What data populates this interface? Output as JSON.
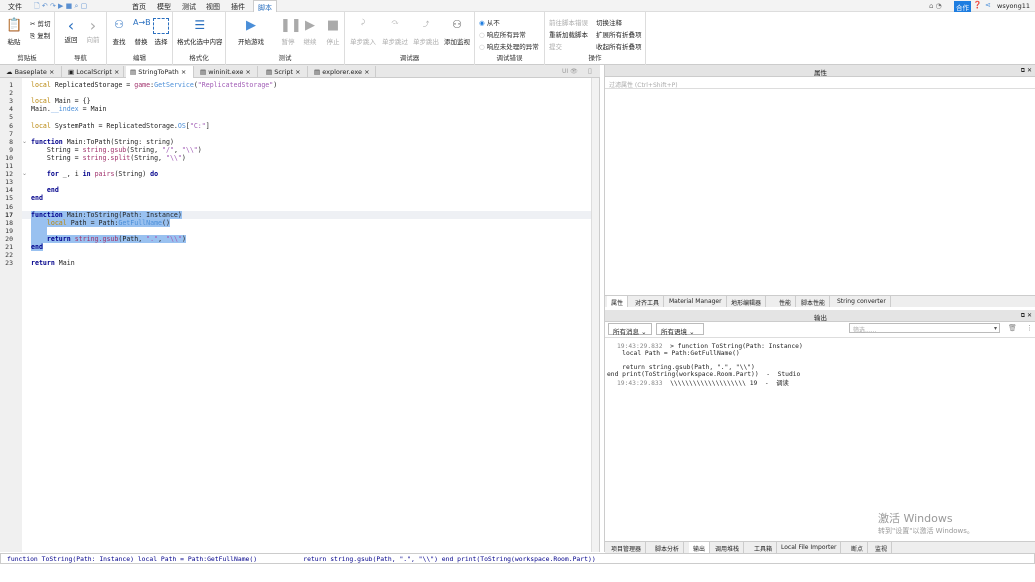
{
  "menu": {
    "file": "文件",
    "items": [
      "首页",
      "模型",
      "测试",
      "视图",
      "插件",
      "脚本"
    ],
    "active": "脚本"
  },
  "titlebar": {
    "collab": "合作",
    "user": "wsyong11"
  },
  "ribbon": {
    "clipboard": {
      "paste": "粘贴",
      "cut": "剪切",
      "copy": "复制",
      "label": "剪贴板"
    },
    "nav": {
      "back": "返回",
      "forward": "向前",
      "label": "导航"
    },
    "edit": {
      "find": "查找",
      "replace": "替换",
      "select": "选择",
      "label": "编辑"
    },
    "format": {
      "format_selection": "格式化选中内容",
      "label": "格式化"
    },
    "test": {
      "start": "开始游戏",
      "pause": "暂停",
      "resume": "继续",
      "stop": "停止",
      "label": "测试"
    },
    "debugger": {
      "step_into": "单步跳入",
      "step_over": "单步跳过",
      "step_out": "单步跳出",
      "add_watch": "添加监视",
      "label": "调试器"
    },
    "debug_errors": {
      "never": "从不",
      "all": "响应所有异常",
      "unhandled": "响应未处理的异常",
      "label": "调试错误"
    },
    "actions": {
      "goto_error": "前往脚本错误",
      "reload": "重新加载脚本",
      "commit": "提交",
      "toggle_comment": "切换注释",
      "expand_all": "扩展所有折叠项",
      "collapse_all": "收起所有折叠项",
      "label": "操作"
    }
  },
  "tabs": [
    "Baseplate",
    "LocalScript",
    "StringToPath",
    "wininit.exe",
    "Script",
    "explorer.exe"
  ],
  "active_tab": "StringToPath",
  "ui_toggle": "UI",
  "code": [
    [
      [
        "local",
        "kl"
      ],
      [
        " ReplicatedStorage = ",
        "pl"
      ],
      [
        "game",
        "bi"
      ],
      [
        ":",
        "pl"
      ],
      [
        "GetService",
        "fn"
      ],
      [
        "(",
        "pl"
      ],
      [
        "\"ReplicatedStorage\"",
        "st"
      ],
      [
        ")",
        "pl"
      ]
    ],
    [],
    [
      [
        "local",
        "kl"
      ],
      [
        " Main = {}",
        "pl"
      ]
    ],
    [
      [
        "Main.",
        "pl"
      ],
      [
        "__index",
        "fn"
      ],
      [
        " = Main",
        "pl"
      ]
    ],
    [],
    [
      [
        "local",
        "kl"
      ],
      [
        " SystemPath = ReplicatedStorage.",
        "pl"
      ],
      [
        "OS",
        "fn"
      ],
      [
        "[",
        "pl"
      ],
      [
        "\"C:\"",
        "st"
      ],
      [
        "]",
        "pl"
      ]
    ],
    [],
    [
      [
        "function",
        "kw"
      ],
      [
        " Main:ToPath(String: string)",
        "pl"
      ]
    ],
    [
      [
        "    String = ",
        "pl"
      ],
      [
        "string.gsub",
        "bi"
      ],
      [
        "(String, ",
        "pl"
      ],
      [
        "\"/\"",
        "st"
      ],
      [
        ", ",
        "pl"
      ],
      [
        "\"\\\\\"",
        "st"
      ],
      [
        ")",
        "pl"
      ]
    ],
    [
      [
        "    String = ",
        "pl"
      ],
      [
        "string.split",
        "bi"
      ],
      [
        "(String, ",
        "pl"
      ],
      [
        "\"\\\\\"",
        "st"
      ],
      [
        ")",
        "pl"
      ]
    ],
    [],
    [
      [
        "    ",
        "pl"
      ],
      [
        "for",
        "kw"
      ],
      [
        " _, i ",
        "pl"
      ],
      [
        "in",
        "kw"
      ],
      [
        " ",
        "pl"
      ],
      [
        "pairs",
        "bi"
      ],
      [
        "(String) ",
        "pl"
      ],
      [
        "do",
        "kw"
      ]
    ],
    [],
    [
      [
        "    ",
        "pl"
      ],
      [
        "end",
        "kw"
      ]
    ],
    [
      [
        "end",
        "kw"
      ]
    ],
    [],
    [
      [
        "function",
        "kw"
      ],
      [
        " Main:ToString(Path: Instance)",
        "pl"
      ]
    ],
    [
      [
        "    ",
        "pl"
      ],
      [
        "local",
        "kl"
      ],
      [
        " Path = Path:",
        "pl"
      ],
      [
        "GetFullName",
        "fn"
      ],
      [
        "()",
        "pl"
      ]
    ],
    [
      [
        "    ",
        "pl"
      ]
    ],
    [
      [
        "    ",
        "pl"
      ],
      [
        "return",
        "kw"
      ],
      [
        " ",
        "pl"
      ],
      [
        "string.gsub",
        "bi"
      ],
      [
        "(Path, ",
        "pl"
      ],
      [
        "\".\"",
        "st"
      ],
      [
        ", ",
        "pl"
      ],
      [
        "\"\\\\\"",
        "st"
      ],
      [
        ")",
        "pl"
      ]
    ],
    [
      [
        "end",
        "kw"
      ]
    ],
    [],
    [
      [
        "return",
        "kw"
      ],
      [
        " Main",
        "pl"
      ]
    ]
  ],
  "properties": {
    "title": "属性",
    "filter_placeholder": "过滤属性 (Ctrl+Shift+P)"
  },
  "prop_tabs": [
    "属性",
    "对齐工具",
    "Material Manager",
    "地形编辑器",
    "性能",
    "脚本性能",
    "String converter"
  ],
  "output": {
    "title": "输出",
    "messages_filter": "所有消息",
    "context_filter": "所有语境",
    "search_placeholder": "筛选......",
    "lines": [
      {
        "ts": "19:43:29.832",
        "text": "  > function ToString(Path: Instance)"
      },
      {
        "ts": "",
        "text": "    local Path = Path:GetFullName()"
      },
      {
        "ts": "",
        "text": ""
      },
      {
        "ts": "",
        "text": "    return string.gsub(Path, \".\", \"\\\\\")"
      },
      {
        "ts": "",
        "text": "end print(ToString(workspace.Room.Part))  -  Studio"
      },
      {
        "ts": "19:43:29.833",
        "text": "  \\\\\\\\\\\\\\\\\\\\\\\\\\\\\\\\\\\\\\\\ 19  -  调读"
      }
    ]
  },
  "bottom_tabs": [
    "项目管理器",
    "脚本分析",
    "输出",
    "调用堆栈",
    "工具箱",
    "Local File Importer",
    "断点",
    "监视"
  ],
  "active_bottom_tab": "输出",
  "command_bar": "function ToString(Path: Instance) local Path = Path:GetFullName()            return string.gsub(Path, \".\", \"\\\\\") end print(ToString(workspace.Room.Part))",
  "watermark": {
    "line1": "激活 Windows",
    "line2": "转到\"设置\"以激活 Windows。"
  },
  "colors": {
    "accent": "#2a6fbf",
    "selection": "#99c1f0"
  }
}
